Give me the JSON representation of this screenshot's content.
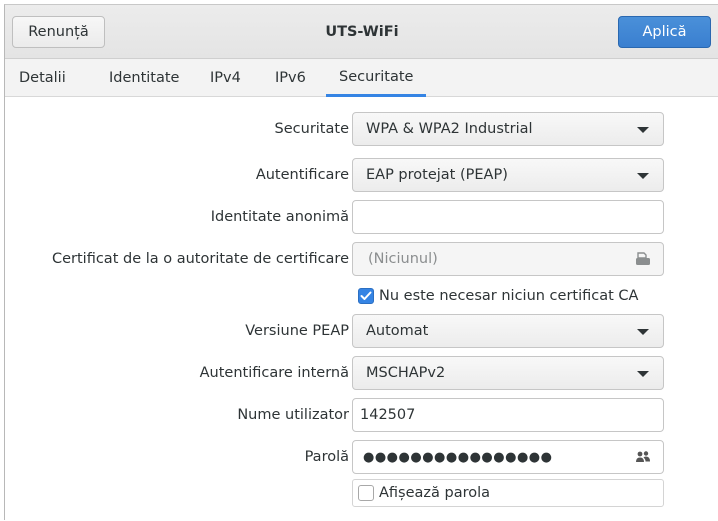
{
  "header": {
    "cancel_label": "Renunță",
    "title": "UTS-WiFi",
    "apply_label": "Aplică"
  },
  "tabs": [
    {
      "label": "Detalii"
    },
    {
      "label": "Identitate"
    },
    {
      "label": "IPv4"
    },
    {
      "label": "IPv6"
    },
    {
      "label": "Securitate",
      "active": true
    }
  ],
  "form": {
    "security": {
      "label": "Securitate",
      "value": "WPA & WPA2 Industrial"
    },
    "authentication": {
      "label": "Autentificare",
      "value": "EAP protejat (PEAP)"
    },
    "anonymous_identity": {
      "label": "Identitate anonimă",
      "value": ""
    },
    "ca_certificate": {
      "label": "Certificat de la o autoritate de certificare",
      "value": "(Niciunul)"
    },
    "no_ca_required": {
      "label": "Nu este necesar niciun certificat CA",
      "checked": true
    },
    "peap_version": {
      "label": "Versiune PEAP",
      "value": "Automat"
    },
    "inner_auth": {
      "label": "Autentificare internă",
      "value": "MSCHAPv2"
    },
    "username": {
      "label": "Nume utilizator",
      "value": "142507"
    },
    "password": {
      "label": "Parolă",
      "value": "●●●●●●●●●●●●●●●●"
    },
    "show_password": {
      "label": "Afișează parola",
      "checked": false
    }
  },
  "colors": {
    "accent": "#3584e4",
    "apply_button": "#3a7fd0"
  },
  "icons": {
    "combo_arrow": "chevron-down-icon",
    "file_chooser": "document-open-icon",
    "password_users": "users-icon",
    "check": "checkmark-icon"
  }
}
